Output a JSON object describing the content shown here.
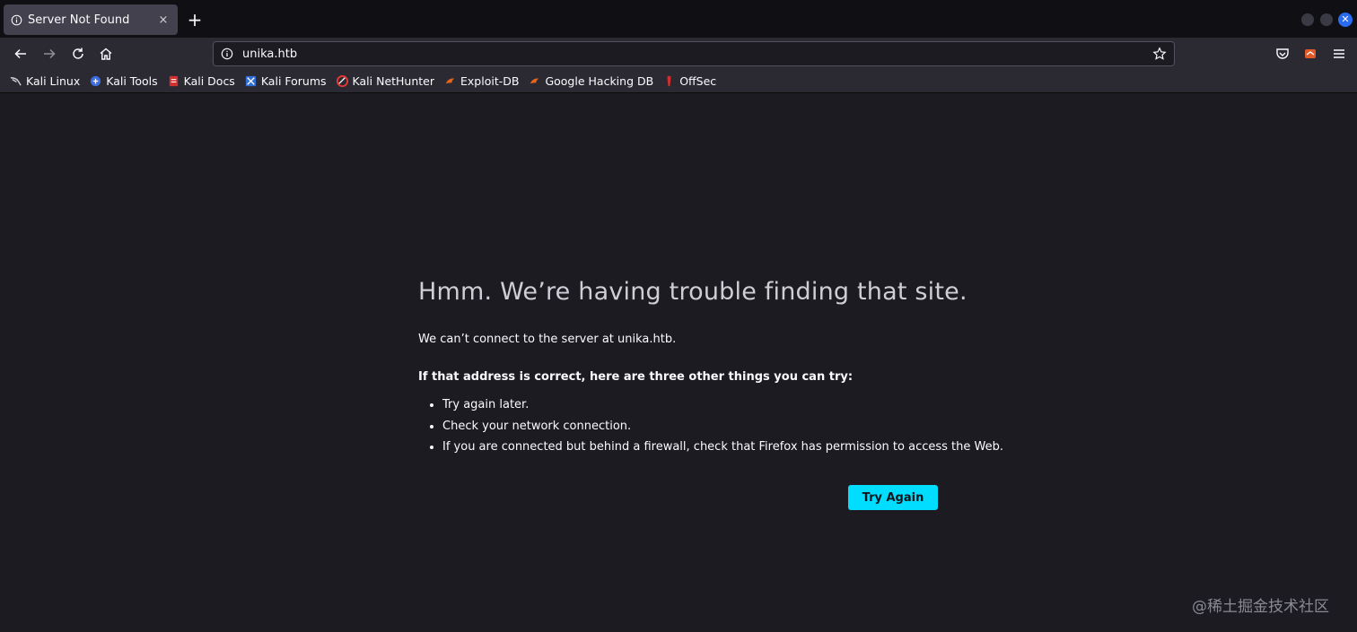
{
  "tab": {
    "title": "Server Not Found",
    "close": "×"
  },
  "newtab": "+",
  "urlbar": {
    "value": "unika.htb"
  },
  "bookmarks": [
    {
      "label": "Kali Linux",
      "icon": "kali-dragon-icon"
    },
    {
      "label": "Kali Tools",
      "icon": "kali-tools-icon"
    },
    {
      "label": "Kali Docs",
      "icon": "kali-docs-icon"
    },
    {
      "label": "Kali Forums",
      "icon": "kali-forums-icon"
    },
    {
      "label": "Kali NetHunter",
      "icon": "nethunter-icon"
    },
    {
      "label": "Exploit-DB",
      "icon": "exploit-db-icon"
    },
    {
      "label": "Google Hacking DB",
      "icon": "ghdb-icon"
    },
    {
      "label": "OffSec",
      "icon": "offsec-icon"
    }
  ],
  "error": {
    "title": "Hmm. We’re having trouble finding that site.",
    "description": "We can’t connect to the server at unika.htb.",
    "subhead": "If that address is correct, here are three other things you can try:",
    "tips": [
      "Try again later.",
      "Check your network connection.",
      "If you are connected but behind a firewall, check that Firefox has permission to access the Web."
    ],
    "button": "Try Again"
  },
  "watermark": "@稀土掘金技术社区",
  "colors": {
    "accent": "#00ddff",
    "background": "#1c1b22",
    "toolbar": "#2b2a33"
  }
}
